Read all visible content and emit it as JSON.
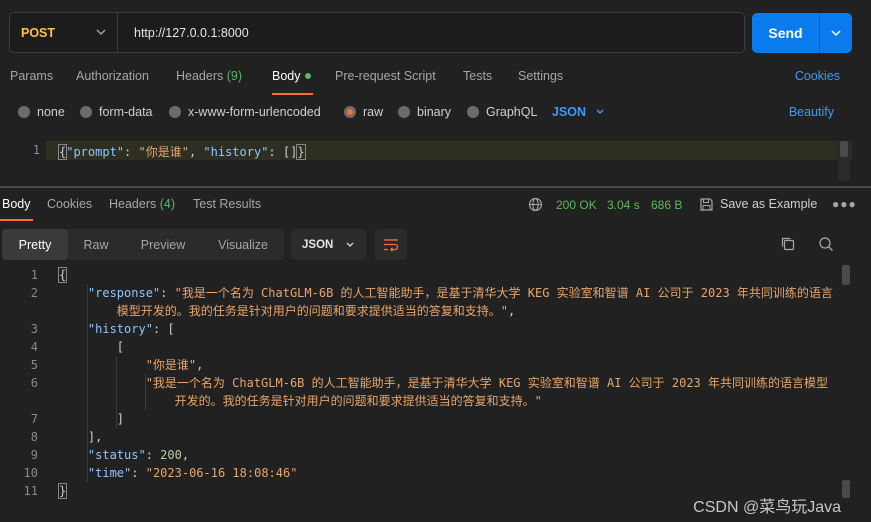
{
  "request": {
    "method": "POST",
    "url": "http://127.0.0.1:8000",
    "send_label": "Send"
  },
  "request_tabs": [
    {
      "label": "Params"
    },
    {
      "label": "Authorization"
    },
    {
      "label": "Headers",
      "count": "(9)"
    },
    {
      "label": "Body"
    },
    {
      "label": "Pre-request Script"
    },
    {
      "label": "Tests"
    },
    {
      "label": "Settings"
    }
  ],
  "cookies_label": "Cookies",
  "body_types": [
    {
      "label": "none"
    },
    {
      "label": "form-data"
    },
    {
      "label": "x-www-form-urlencoded"
    },
    {
      "label": "raw"
    },
    {
      "label": "binary"
    },
    {
      "label": "GraphQL"
    }
  ],
  "body_format": "JSON",
  "beautify_label": "Beautify",
  "request_body": {
    "line_number": "1",
    "prompt_key": "\"prompt\"",
    "prompt_value": "\"你是谁\"",
    "history_key": "\"history\""
  },
  "response_tabs": [
    {
      "label": "Body"
    },
    {
      "label": "Cookies"
    },
    {
      "label": "Headers",
      "count": "(4)"
    },
    {
      "label": "Test Results"
    }
  ],
  "response_status": {
    "status": "200 OK",
    "time": "3.04 s",
    "size": "686 B",
    "save_label": "Save as Example"
  },
  "format_tabs": [
    "Pretty",
    "Raw",
    "Preview",
    "Visualize"
  ],
  "response_format": "JSON",
  "response_body": {
    "line_numbers": [
      "1",
      "2",
      "",
      "3",
      "4",
      "5",
      "6",
      "",
      "7",
      "8",
      "9",
      "10",
      "11"
    ],
    "response_key": "\"response\"",
    "response_value_1": "\"我是一个名为 ChatGLM-6B 的人工智能助手，是基于清华大学 KEG 实验室和智谱 AI 公司于 2023 年共同训练的语言",
    "response_value_2": "模型开发的。我的任务是针对用户的问题和要求提供适当的答复和支持。\"",
    "history_key": "\"history\"",
    "history_q": "\"你是谁\"",
    "history_a_1": "\"我是一个名为 ChatGLM-6B 的人工智能助手，是基于清华大学 KEG 实验室和智谱 AI 公司于 2023 年共同训练的语言模型",
    "history_a_2": "开发的。我的任务是针对用户的问题和要求提供适当的答复和支持。\"",
    "status_key": "\"status\"",
    "status_value": "200",
    "time_key": "\"time\"",
    "time_value": "\"2023-06-16 18:08:46\""
  },
  "watermark": "CSDN @菜鸟玩Java",
  "colors": {
    "accent": "#ff6c37",
    "send": "#097bed",
    "method": "#ffc24b",
    "link": "#3b9bf5",
    "status_ok": "#5cb85c"
  }
}
